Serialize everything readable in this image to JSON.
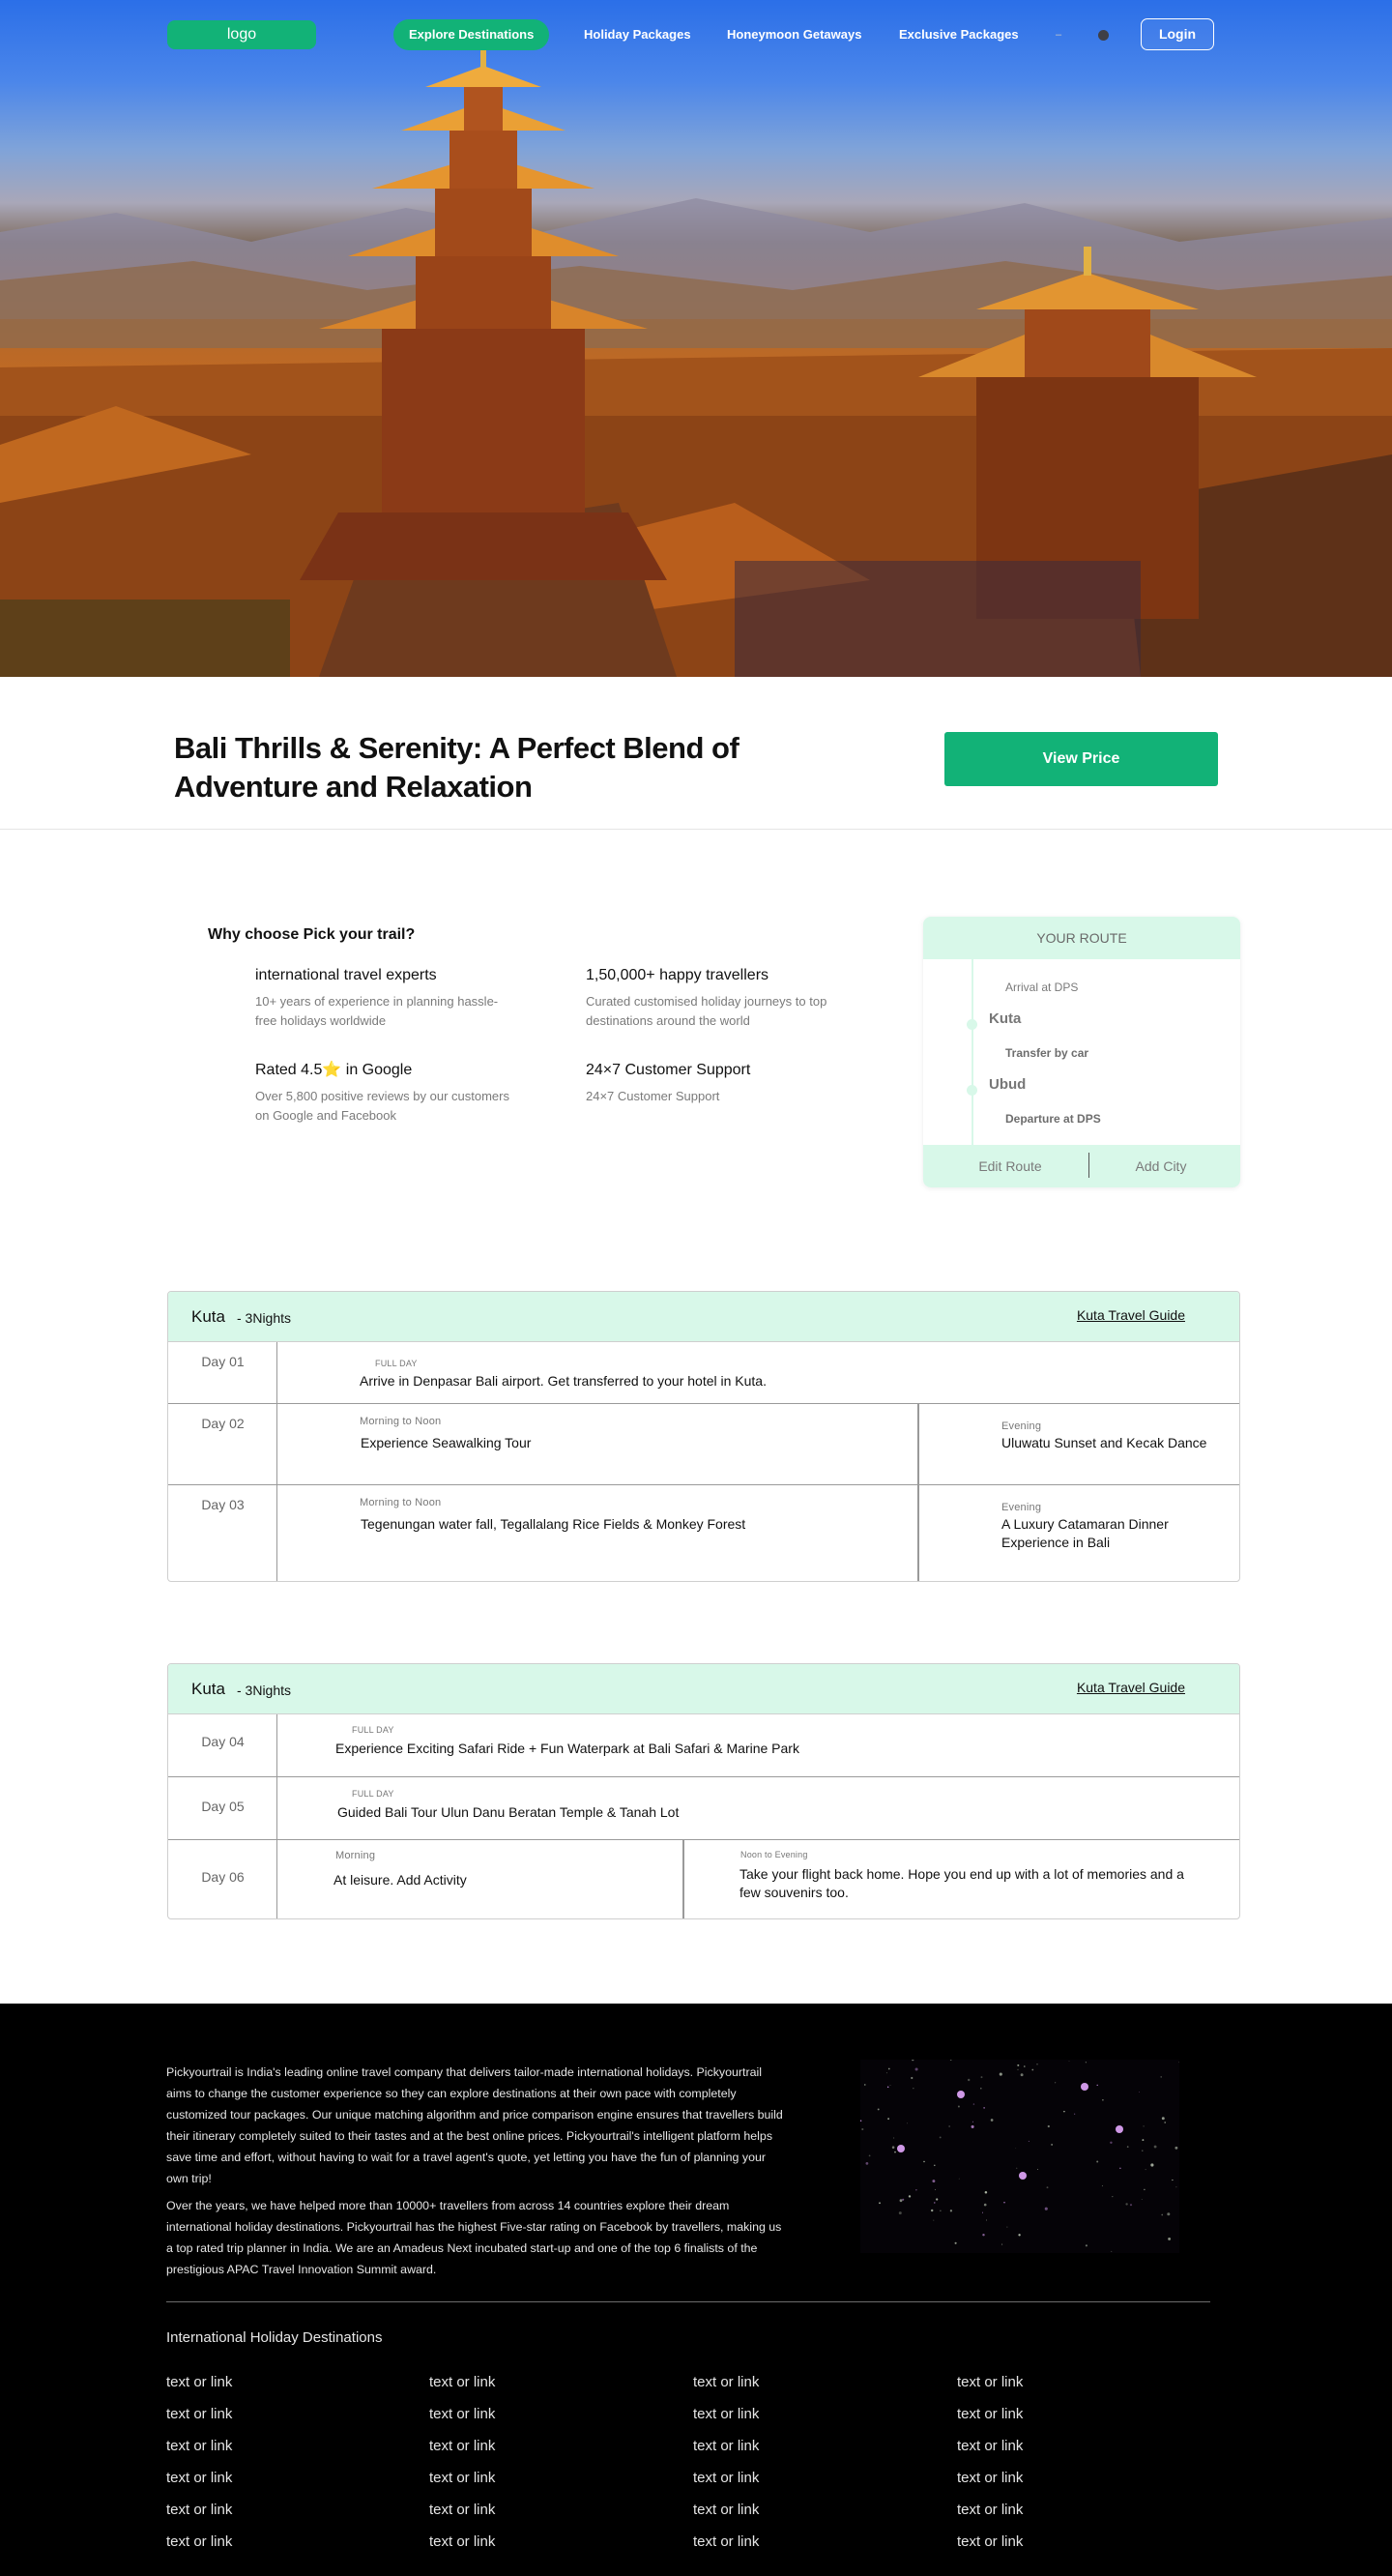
{
  "nav": {
    "logo": "logo",
    "links": [
      "Explore Destinations",
      "Holiday Packages",
      "Honeymoon Getaways",
      "Exclusive Packages"
    ],
    "active_index": 0,
    "dash": "–",
    "login": "Login"
  },
  "title": {
    "heading": "Bali Thrills & Serenity: A Perfect Blend of Adventure and Relaxation",
    "cta": "View Price"
  },
  "why": {
    "heading": "Why choose Pick your trail?",
    "features": [
      {
        "title": "international travel experts",
        "desc": "10+ years of experience in planning hassle-free holidays worldwide"
      },
      {
        "title": "1,50,000+ happy travellers",
        "desc": "Curated customised holiday journeys to top destinations around the world"
      },
      {
        "title_prefix": "Rated 4.5",
        "title_star": "⭐",
        "title_suffix": " in Google",
        "desc": "Over 5,800 positive reviews by our customers on Google and Facebook"
      },
      {
        "title": "24×7 Customer Support",
        "desc": "24×7 Customer Support"
      }
    ]
  },
  "route": {
    "heading": "YOUR ROUTE",
    "arrival": "Arrival at DPS",
    "stops": [
      "Kuta",
      "Ubud"
    ],
    "transfer": "Transfer by car",
    "departure": "Departure at DPS",
    "edit": "Edit Route",
    "add_city": "Add City"
  },
  "itinerary": [
    {
      "city": "Kuta",
      "nights": "- 3Nights",
      "guide": "Kuta Travel Guide",
      "days": [
        {
          "day": "Day 01",
          "slots": [
            {
              "label": "FULL DAY",
              "text": "Arrive in Denpasar Bali airport. Get transferred to your hotel in Kuta."
            }
          ]
        },
        {
          "day": "Day 02",
          "slots": [
            {
              "label": "Morning to Noon",
              "text": "Experience Seawalking Tour"
            },
            {
              "label": "Evening",
              "text": "Uluwatu Sunset and Kecak Dance"
            }
          ]
        },
        {
          "day": "Day 03",
          "slots": [
            {
              "label": "Morning to Noon",
              "text": "Tegenungan water fall, Tegallalang Rice Fields & Monkey Forest"
            },
            {
              "label": "Evening",
              "text": "A Luxury Catamaran Dinner Experience in Bali"
            }
          ]
        }
      ]
    },
    {
      "city": "Kuta",
      "nights": "- 3Nights",
      "guide": "Kuta Travel Guide",
      "days": [
        {
          "day": "Day 04",
          "slots": [
            {
              "label": "FULL DAY",
              "text": "Experience Exciting Safari Ride + Fun Waterpark at Bali Safari & Marine Park"
            }
          ]
        },
        {
          "day": "Day 05",
          "slots": [
            {
              "label": "FULL DAY",
              "text": "Guided Bali Tour Ulun Danu Beratan Temple & Tanah Lot"
            }
          ]
        },
        {
          "day": "Day 06",
          "slots": [
            {
              "label": "Morning",
              "text": "At leisure. Add Activity"
            },
            {
              "label": "Noon to Evening",
              "text": "Take your flight back home. Hope you end up with a lot of memories and a few souvenirs too."
            }
          ]
        }
      ]
    }
  ],
  "footer": {
    "about": [
      "Pickyourtrail is India's leading online travel company that delivers tailor-made international holidays. Pickyourtrail aims to change the customer experience so they can explore destinations at their own pace with completely customized tour packages. Our unique matching algorithm and price comparison engine ensures that travellers build their itinerary completely suited to their tastes and at the best online prices. Pickyourtrail's intelligent platform helps save time and effort, without having to wait for a travel agent's quote, yet letting you have the fun of planning your own trip!",
      "Over the years, we have helped more than 10000+ travellers from across 14 countries explore their dream international holiday destinations. Pickyourtrail has the highest Five-star rating on Facebook by travellers, making us a top rated trip planner in India. We are an Amadeus Next incubated start-up and one of the top 6 finalists of the prestigious APAC Travel Innovation Summit award."
    ],
    "heading": "International Holiday Destinations",
    "link_text": "text or link",
    "link_columns": 4,
    "link_rows": 6
  },
  "colors": {
    "accent": "#12b277",
    "mint": "#d8f8e9",
    "footer_bg": "#000000"
  }
}
